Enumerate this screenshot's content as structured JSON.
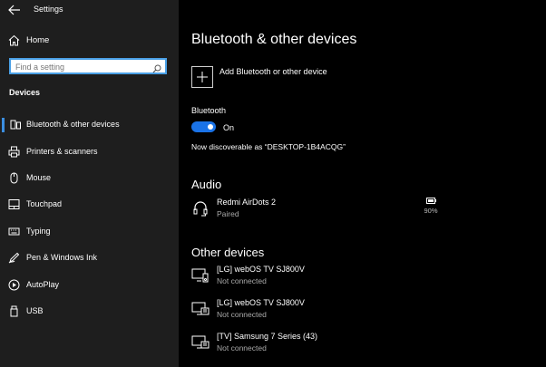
{
  "window": {
    "title": "Settings"
  },
  "sidebar": {
    "home_label": "Home",
    "search_placeholder": "Find a setting",
    "section": "Devices",
    "items": [
      {
        "label": "Bluetooth & other devices",
        "icon": "bluetooth-devices-icon",
        "selected": true
      },
      {
        "label": "Printers & scanners",
        "icon": "printer-icon"
      },
      {
        "label": "Mouse",
        "icon": "mouse-icon"
      },
      {
        "label": "Touchpad",
        "icon": "touchpad-icon"
      },
      {
        "label": "Typing",
        "icon": "keyboard-icon"
      },
      {
        "label": "Pen & Windows Ink",
        "icon": "pen-icon"
      },
      {
        "label": "AutoPlay",
        "icon": "autoplay-icon"
      },
      {
        "label": "USB",
        "icon": "usb-icon"
      }
    ]
  },
  "main": {
    "title": "Bluetooth & other devices",
    "add_device_label": "Add Bluetooth or other device",
    "bluetooth_label": "Bluetooth",
    "bluetooth_state": "On",
    "bluetooth_on": true,
    "discoverable_text": "Now discoverable as “DESKTOP-1B4ACQG”",
    "audio_heading": "Audio",
    "audio_devices": [
      {
        "name": "Redmi AirDots 2",
        "status": "Paired",
        "battery": "90%",
        "icon": "headset-icon"
      }
    ],
    "other_heading": "Other devices",
    "other_devices": [
      {
        "name": "[LG] webOS TV SJ800V",
        "status": "Not connected",
        "icon": "media-device-icon"
      },
      {
        "name": "[LG] webOS TV SJ800V",
        "status": "Not connected",
        "icon": "display-device-icon"
      },
      {
        "name": "[TV] Samsung 7 Series (43)",
        "status": "Not connected",
        "icon": "display-device-icon"
      }
    ]
  },
  "colors": {
    "accent": "#1a73e8",
    "sidebar_bg": "#1e1e1e",
    "main_bg": "#000000"
  }
}
